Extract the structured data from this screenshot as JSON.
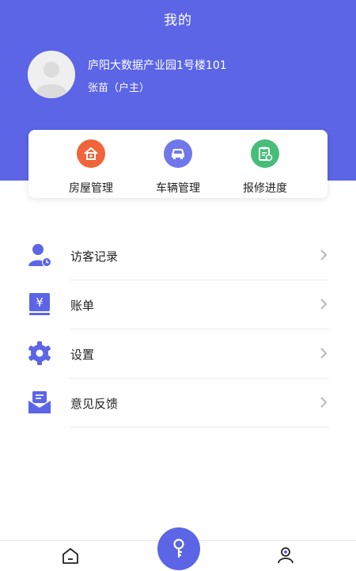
{
  "header": {
    "title": "我的"
  },
  "profile": {
    "address": "庐阳大数据产业园1号楼101",
    "name_role": "张苗（户主）",
    "avatar_icon": "default-avatar-icon"
  },
  "quick_actions": [
    {
      "label": "房屋管理",
      "icon": "house-icon",
      "color": "#f0643a"
    },
    {
      "label": "车辆管理",
      "icon": "car-icon",
      "color": "#6e78ea"
    },
    {
      "label": "报修进度",
      "icon": "clipboard-progress-icon",
      "color": "#47bd7a"
    }
  ],
  "menu": [
    {
      "label": "访客记录",
      "icon": "visitor-clock-icon"
    },
    {
      "label": "账单",
      "icon": "bill-yuan-icon"
    },
    {
      "label": "设置",
      "icon": "gear-icon"
    },
    {
      "label": "意见反馈",
      "icon": "feedback-mail-icon"
    }
  ],
  "tabbar": {
    "home_icon": "home-icon",
    "center_icon": "key-icon",
    "me_icon": "user-icon"
  },
  "colors": {
    "primary": "#5b65e6",
    "separator": "#ececec",
    "chevron": "#b8b8b8"
  }
}
